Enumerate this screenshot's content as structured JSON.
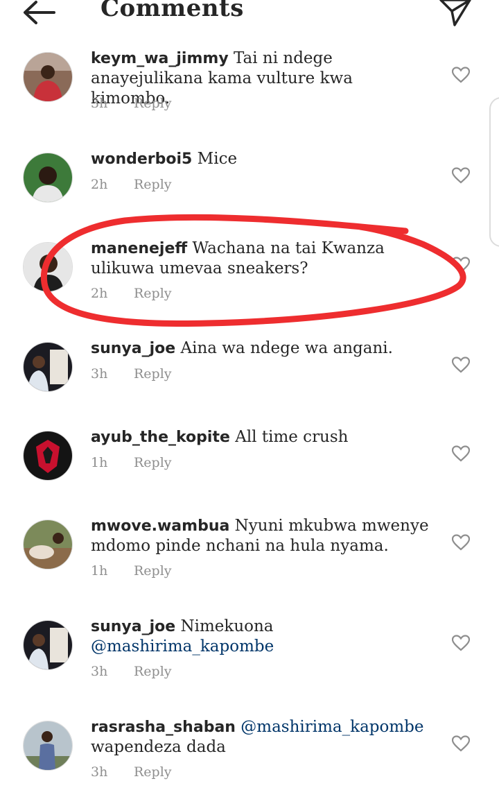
{
  "header": {
    "title": "Comments"
  },
  "colors": {
    "annotation": "#ee2d2f",
    "mention": "#003569",
    "meta": "#8e8e8e"
  },
  "comments": [
    {
      "username": "keym_wa_jimmy",
      "text": "Tai ni ndege anayejulikana kama vulture kwa kimombo.",
      "time": "3h",
      "reply": "Reply"
    },
    {
      "username": "wonderboi5",
      "text": "Mice",
      "time": "2h",
      "reply": "Reply"
    },
    {
      "username": "manenejeff",
      "text": "Wachana na tai Kwanza ulikuwa umevaa sneakers?",
      "time": "2h",
      "reply": "Reply"
    },
    {
      "username": "sunya_joe",
      "text": "Aina wa ndege wa angani.",
      "time": "3h",
      "reply": "Reply"
    },
    {
      "username": "ayub_the_kopite",
      "text": "All time crush",
      "time": "1h",
      "reply": "Reply"
    },
    {
      "username": "mwove.wambua",
      "text": "Nyuni mkubwa mwenye mdomo pinde nchani na hula nyama.",
      "time": "1h",
      "reply": "Reply"
    },
    {
      "username": "sunya_joe",
      "text": "Nimekuona",
      "mention": "@mashirima_kapombe",
      "time": "3h",
      "reply": "Reply"
    },
    {
      "username": "rasrasha_shaban",
      "mention": "@mashirima_kapombe",
      "text": "wapendeza dada",
      "time": "3h",
      "reply": "Reply"
    }
  ]
}
